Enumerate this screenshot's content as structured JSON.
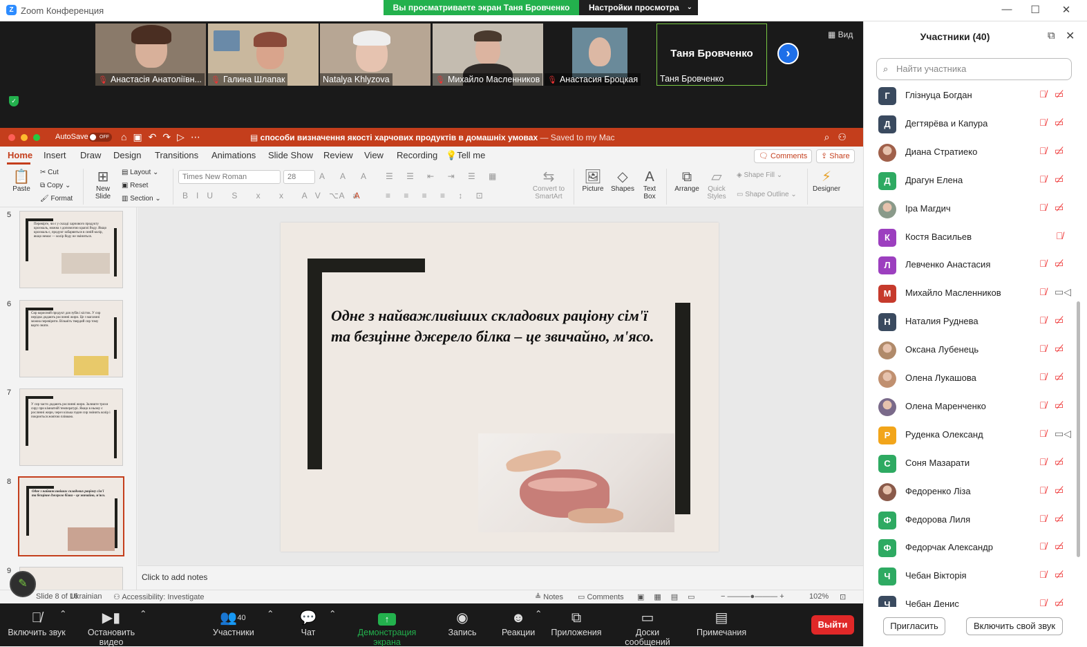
{
  "zoom": {
    "app_title": "Zoom Конференция",
    "share_banner": "Вы просматриваете экран Таня Бровченко",
    "view_options": "Настройки просмотра",
    "view_button": "Вид",
    "tiles": [
      {
        "name": "Анастасія Анатоліївн..."
      },
      {
        "name": "Галина Шлапак"
      },
      {
        "name": "Natalya Khlyzova"
      },
      {
        "name": "Михайло Масленников"
      },
      {
        "name": "Анастасия Броцкая"
      }
    ],
    "active_tile": {
      "big_name": "Таня Бровченко",
      "name": "Таня Бровченко"
    },
    "toolbar": {
      "mute": "Включить звук",
      "video": "Остановить видео",
      "participants": "Участники",
      "participants_count": "40",
      "chat": "Чат",
      "share": "Демонстрация экрана",
      "record": "Запись",
      "reactions": "Реакции",
      "apps": "Приложения",
      "whiteboards": "Доски сообщений",
      "notes": "Примечания",
      "leave": "Выйти"
    }
  },
  "panel": {
    "title": "Участники (40)",
    "search_placeholder": "Найти участника",
    "invite": "Пригласить",
    "unmute_me": "Включить свой звук",
    "participants": [
      {
        "initial": "Г",
        "name": "Глізнуца Богдан",
        "color": "#3a4a5f",
        "cam": "off"
      },
      {
        "initial": "Д",
        "name": "Дегтярёва и Капура",
        "color": "#3a4a5f",
        "cam": "off"
      },
      {
        "initial": "",
        "name": "Диана Стратиеко",
        "color": "#a0604a",
        "cam": "off"
      },
      {
        "initial": "Д",
        "name": "Драгун Елена",
        "color": "#2eaa62",
        "cam": "off"
      },
      {
        "initial": "",
        "name": "Іра Магдич",
        "color": "#8a9a8a",
        "cam": "off"
      },
      {
        "initial": "К",
        "name": "Костя Васильев",
        "color": "#9c3fbf",
        "cam": "none"
      },
      {
        "initial": "Л",
        "name": "Левченко Анастасия",
        "color": "#9c3fbf",
        "cam": "off"
      },
      {
        "initial": "М",
        "name": "Михайло Масленников",
        "color": "#c63a2c",
        "cam": "on"
      },
      {
        "initial": "Н",
        "name": "Наталия Руднева",
        "color": "#3a4a5f",
        "cam": "off"
      },
      {
        "initial": "",
        "name": "Оксана Лубенець",
        "color": "#b08a6a",
        "cam": "off"
      },
      {
        "initial": "",
        "name": "Олена Лукашова",
        "color": "#c09070",
        "cam": "off"
      },
      {
        "initial": "",
        "name": "Олена Маренченко",
        "color": "#7a6a8a",
        "cam": "off"
      },
      {
        "initial": "Р",
        "name": "Руденка Олександ",
        "color": "#f2a51a",
        "cam": "on"
      },
      {
        "initial": "С",
        "name": "Соня Мазарати",
        "color": "#2eaa62",
        "cam": "off"
      },
      {
        "initial": "",
        "name": "Федоренко Ліза",
        "color": "#8a5a4a",
        "cam": "off"
      },
      {
        "initial": "Ф",
        "name": "Федорова Лиля",
        "color": "#2eaa62",
        "cam": "off"
      },
      {
        "initial": "Ф",
        "name": "Федорчак Александр",
        "color": "#2eaa62",
        "cam": "off"
      },
      {
        "initial": "Ч",
        "name": "Чебан Вікторія",
        "color": "#2eaa62",
        "cam": "off"
      },
      {
        "initial": "Ч",
        "name": "Чебан Денис",
        "color": "#3a4a5f",
        "cam": "off"
      }
    ]
  },
  "ppt": {
    "autosave": "AutoSave",
    "autosave_state": "OFF",
    "doc_title": "способи визначення якості харчових продуктів в домашніх умовах",
    "saved_status": "— Saved to my Mac",
    "tabs": [
      "Home",
      "Insert",
      "Draw",
      "Design",
      "Transitions",
      "Animations",
      "Slide Show",
      "Review",
      "View",
      "Recording",
      "Tell me"
    ],
    "comments": "Comments",
    "share": "Share",
    "ribbon": {
      "paste": "Paste",
      "cut": "Cut",
      "copy": "Copy",
      "format": "Format",
      "new_slide": "New Slide",
      "layout": "Layout",
      "reset": "Reset",
      "section": "Section",
      "font": "Times New Roman",
      "size": "28",
      "convert": "Convert to SmartArt",
      "picture": "Picture",
      "shapes": "Shapes",
      "text_box": "Text Box",
      "arrange": "Arrange",
      "quick_styles": "Quick Styles",
      "shape_fill": "Shape Fill",
      "shape_outline": "Shape Outline",
      "designer": "Designer"
    },
    "thumbs": [
      {
        "num": "5",
        "text": "Перевірте, чи є у складі харчового продукту крохмаль, можна з допомогою краплі йоду. Якщо крохмаль є, продукт забарвиться в синій колір, якщо немає — колір йоду не зміниться."
      },
      {
        "num": "6",
        "text": "Сир корисний продукт для зубів і кісток. У сир нерідко додають рослинні жири. Це з магазині можна перевірити. Візьміть твердий сир тому варто знати."
      },
      {
        "num": "7",
        "text": "У сир часто додають рослинні жири. Залиште трохи сиру при кімнатній температурі. Якщо в ньому є рослинні жири, через кілька годин сир змінить колір і покриється жовтою плівкою."
      },
      {
        "num": "8",
        "text": "Одне з найважливіших складових раціону сім'ї та безцінне джерело білка – це звичайно, м'ясо."
      },
      {
        "num": "9",
        "text": ""
      }
    ],
    "slide_text": "Одне з найважливіших складових раціону сім'ї та безцінне джерело білка – це звичайно,  м'ясо.",
    "notes_placeholder": "Click to add notes",
    "status": {
      "slide": "Slide 8 of 16",
      "language": "Ukrainian",
      "accessibility": "Accessibility: Investigate",
      "notes": "Notes",
      "comments": "Comments",
      "zoom": "102%"
    }
  }
}
